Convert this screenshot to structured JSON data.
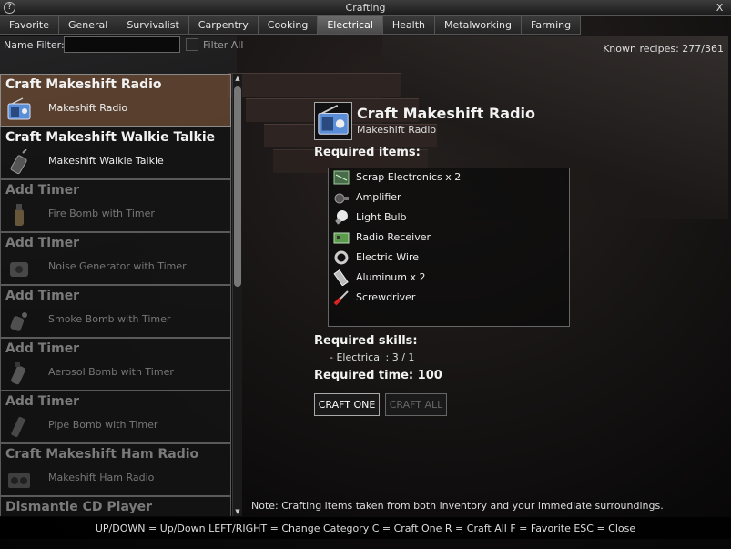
{
  "window": {
    "title": "Crafting",
    "help_label": "?",
    "close_label": "X"
  },
  "tabs": [
    {
      "label": "Favorite"
    },
    {
      "label": "General"
    },
    {
      "label": "Survivalist"
    },
    {
      "label": "Carpentry"
    },
    {
      "label": "Cooking"
    },
    {
      "label": "Electrical"
    },
    {
      "label": "Health"
    },
    {
      "label": "Metalworking"
    },
    {
      "label": "Farming"
    }
  ],
  "active_tab": "Electrical",
  "filter": {
    "label": "Name Filter:",
    "value": "",
    "filter_all_label": "Filter All"
  },
  "known_recipes": "Known recipes:  277/361",
  "recipes": [
    {
      "name": "Craft Makeshift Radio",
      "result": "Makeshift Radio",
      "icon": "radio-icon",
      "available": true,
      "selected": true
    },
    {
      "name": "Craft Makeshift Walkie Talkie",
      "result": "Makeshift Walkie Talkie",
      "icon": "walkie-talkie-icon",
      "available": true,
      "selected": false
    },
    {
      "name": "Add Timer",
      "result": "Fire Bomb with Timer",
      "icon": "fire-bomb-icon",
      "available": false,
      "selected": false
    },
    {
      "name": "Add Timer",
      "result": "Noise Generator with Timer",
      "icon": "noise-generator-icon",
      "available": false,
      "selected": false
    },
    {
      "name": "Add Timer",
      "result": "Smoke Bomb with Timer",
      "icon": "smoke-bomb-icon",
      "available": false,
      "selected": false
    },
    {
      "name": "Add Timer",
      "result": "Aerosol Bomb with Timer",
      "icon": "aerosol-bomb-icon",
      "available": false,
      "selected": false
    },
    {
      "name": "Add Timer",
      "result": "Pipe Bomb with Timer",
      "icon": "pipe-bomb-icon",
      "available": false,
      "selected": false
    },
    {
      "name": "Craft Makeshift Ham Radio",
      "result": "Makeshift Ham Radio",
      "icon": "ham-radio-icon",
      "available": false,
      "selected": false
    },
    {
      "name": "Dismantle CD Player",
      "result": "",
      "icon": "cd-player-icon",
      "available": false,
      "selected": false
    }
  ],
  "detail": {
    "title": "Craft Makeshift Radio",
    "result": "Makeshift Radio",
    "icon": "radio-icon",
    "required_items_label": "Required items:",
    "items": [
      {
        "name": "Scrap Electronics x 2",
        "icon": "scrap-electronics-icon"
      },
      {
        "name": "Amplifier",
        "icon": "amplifier-icon"
      },
      {
        "name": "Light Bulb",
        "icon": "light-bulb-icon"
      },
      {
        "name": "Radio Receiver",
        "icon": "radio-receiver-icon"
      },
      {
        "name": "Electric Wire",
        "icon": "electric-wire-icon"
      },
      {
        "name": "Aluminum x 2",
        "icon": "aluminum-icon"
      },
      {
        "name": "Screwdriver",
        "icon": "screwdriver-icon"
      }
    ],
    "required_skills_label": "Required skills:",
    "skills": [
      "- Electrical : 3 / 1"
    ],
    "required_time": "Required time: 100",
    "craft_one_label": "CRAFT ONE",
    "craft_all_label": "CRAFT ALL"
  },
  "note": "Note: Crafting items taken from both inventory and your immediate surroundings.",
  "footer_hint": "UP/DOWN = Up/Down    LEFT/RIGHT = Change Category    C = Craft One    R = Craft All    F = Favorite    ESC = Close"
}
